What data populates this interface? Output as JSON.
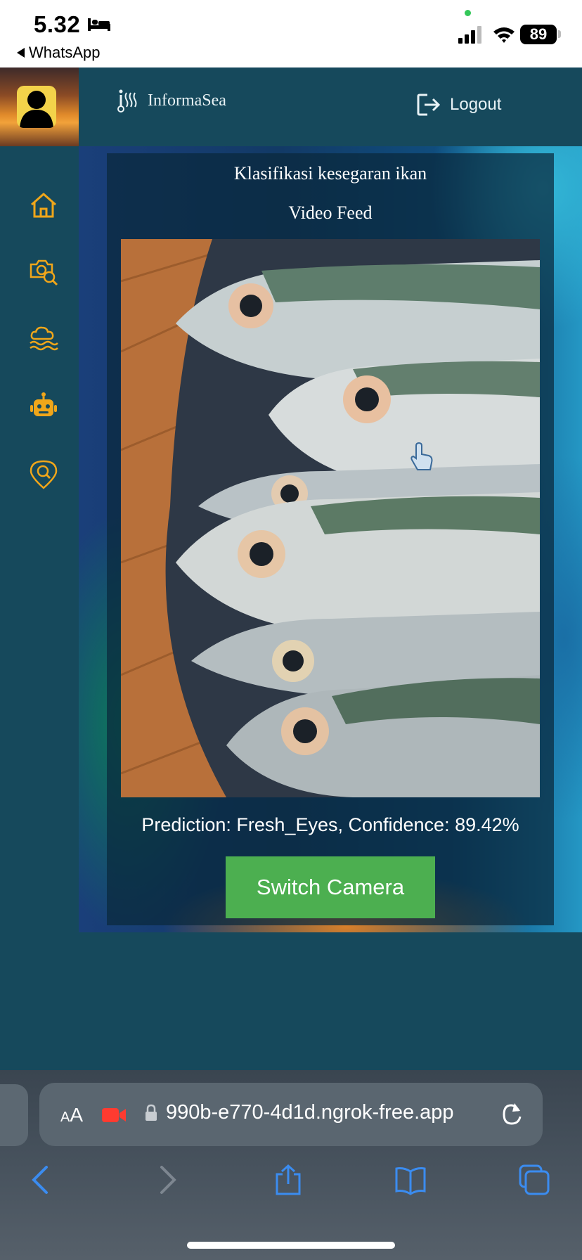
{
  "status_bar": {
    "time": "5.32",
    "back_app": "WhatsApp",
    "battery": "89"
  },
  "header": {
    "brand": "InformaSea",
    "logout_label": "Logout"
  },
  "sidebar": {
    "items": [
      {
        "icon": "home-icon"
      },
      {
        "icon": "camera-search-icon"
      },
      {
        "icon": "cloud-sea-icon"
      },
      {
        "icon": "robot-icon"
      },
      {
        "icon": "location-search-icon"
      }
    ],
    "icon_color": "#f0a61a"
  },
  "main": {
    "title": "Klasifikasi kesegaran ikan",
    "subtitle": "Video Feed",
    "prediction": "Prediction: Fresh_Eyes, Confidence: 89.42%",
    "switch_camera_label": "Switch Camera"
  },
  "browser": {
    "text_size_label_small": "A",
    "text_size_label_large": "A",
    "url": "990b-e770-4d1d.ngrok-free.app"
  },
  "colors": {
    "nav_bg": "#16495c",
    "accent_icon": "#f0a61a",
    "button_green": "#4caf50"
  }
}
